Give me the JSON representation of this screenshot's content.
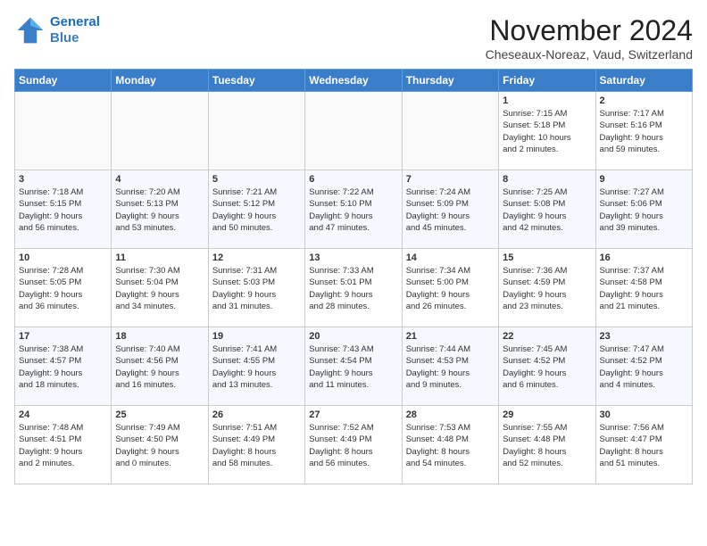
{
  "header": {
    "logo_line1": "General",
    "logo_line2": "Blue",
    "month": "November 2024",
    "location": "Cheseaux-Noreaz, Vaud, Switzerland"
  },
  "weekdays": [
    "Sunday",
    "Monday",
    "Tuesday",
    "Wednesday",
    "Thursday",
    "Friday",
    "Saturday"
  ],
  "weeks": [
    [
      {
        "day": "",
        "info": ""
      },
      {
        "day": "",
        "info": ""
      },
      {
        "day": "",
        "info": ""
      },
      {
        "day": "",
        "info": ""
      },
      {
        "day": "",
        "info": ""
      },
      {
        "day": "1",
        "info": "Sunrise: 7:15 AM\nSunset: 5:18 PM\nDaylight: 10 hours\nand 2 minutes."
      },
      {
        "day": "2",
        "info": "Sunrise: 7:17 AM\nSunset: 5:16 PM\nDaylight: 9 hours\nand 59 minutes."
      }
    ],
    [
      {
        "day": "3",
        "info": "Sunrise: 7:18 AM\nSunset: 5:15 PM\nDaylight: 9 hours\nand 56 minutes."
      },
      {
        "day": "4",
        "info": "Sunrise: 7:20 AM\nSunset: 5:13 PM\nDaylight: 9 hours\nand 53 minutes."
      },
      {
        "day": "5",
        "info": "Sunrise: 7:21 AM\nSunset: 5:12 PM\nDaylight: 9 hours\nand 50 minutes."
      },
      {
        "day": "6",
        "info": "Sunrise: 7:22 AM\nSunset: 5:10 PM\nDaylight: 9 hours\nand 47 minutes."
      },
      {
        "day": "7",
        "info": "Sunrise: 7:24 AM\nSunset: 5:09 PM\nDaylight: 9 hours\nand 45 minutes."
      },
      {
        "day": "8",
        "info": "Sunrise: 7:25 AM\nSunset: 5:08 PM\nDaylight: 9 hours\nand 42 minutes."
      },
      {
        "day": "9",
        "info": "Sunrise: 7:27 AM\nSunset: 5:06 PM\nDaylight: 9 hours\nand 39 minutes."
      }
    ],
    [
      {
        "day": "10",
        "info": "Sunrise: 7:28 AM\nSunset: 5:05 PM\nDaylight: 9 hours\nand 36 minutes."
      },
      {
        "day": "11",
        "info": "Sunrise: 7:30 AM\nSunset: 5:04 PM\nDaylight: 9 hours\nand 34 minutes."
      },
      {
        "day": "12",
        "info": "Sunrise: 7:31 AM\nSunset: 5:03 PM\nDaylight: 9 hours\nand 31 minutes."
      },
      {
        "day": "13",
        "info": "Sunrise: 7:33 AM\nSunset: 5:01 PM\nDaylight: 9 hours\nand 28 minutes."
      },
      {
        "day": "14",
        "info": "Sunrise: 7:34 AM\nSunset: 5:00 PM\nDaylight: 9 hours\nand 26 minutes."
      },
      {
        "day": "15",
        "info": "Sunrise: 7:36 AM\nSunset: 4:59 PM\nDaylight: 9 hours\nand 23 minutes."
      },
      {
        "day": "16",
        "info": "Sunrise: 7:37 AM\nSunset: 4:58 PM\nDaylight: 9 hours\nand 21 minutes."
      }
    ],
    [
      {
        "day": "17",
        "info": "Sunrise: 7:38 AM\nSunset: 4:57 PM\nDaylight: 9 hours\nand 18 minutes."
      },
      {
        "day": "18",
        "info": "Sunrise: 7:40 AM\nSunset: 4:56 PM\nDaylight: 9 hours\nand 16 minutes."
      },
      {
        "day": "19",
        "info": "Sunrise: 7:41 AM\nSunset: 4:55 PM\nDaylight: 9 hours\nand 13 minutes."
      },
      {
        "day": "20",
        "info": "Sunrise: 7:43 AM\nSunset: 4:54 PM\nDaylight: 9 hours\nand 11 minutes."
      },
      {
        "day": "21",
        "info": "Sunrise: 7:44 AM\nSunset: 4:53 PM\nDaylight: 9 hours\nand 9 minutes."
      },
      {
        "day": "22",
        "info": "Sunrise: 7:45 AM\nSunset: 4:52 PM\nDaylight: 9 hours\nand 6 minutes."
      },
      {
        "day": "23",
        "info": "Sunrise: 7:47 AM\nSunset: 4:52 PM\nDaylight: 9 hours\nand 4 minutes."
      }
    ],
    [
      {
        "day": "24",
        "info": "Sunrise: 7:48 AM\nSunset: 4:51 PM\nDaylight: 9 hours\nand 2 minutes."
      },
      {
        "day": "25",
        "info": "Sunrise: 7:49 AM\nSunset: 4:50 PM\nDaylight: 9 hours\nand 0 minutes."
      },
      {
        "day": "26",
        "info": "Sunrise: 7:51 AM\nSunset: 4:49 PM\nDaylight: 8 hours\nand 58 minutes."
      },
      {
        "day": "27",
        "info": "Sunrise: 7:52 AM\nSunset: 4:49 PM\nDaylight: 8 hours\nand 56 minutes."
      },
      {
        "day": "28",
        "info": "Sunrise: 7:53 AM\nSunset: 4:48 PM\nDaylight: 8 hours\nand 54 minutes."
      },
      {
        "day": "29",
        "info": "Sunrise: 7:55 AM\nSunset: 4:48 PM\nDaylight: 8 hours\nand 52 minutes."
      },
      {
        "day": "30",
        "info": "Sunrise: 7:56 AM\nSunset: 4:47 PM\nDaylight: 8 hours\nand 51 minutes."
      }
    ]
  ]
}
